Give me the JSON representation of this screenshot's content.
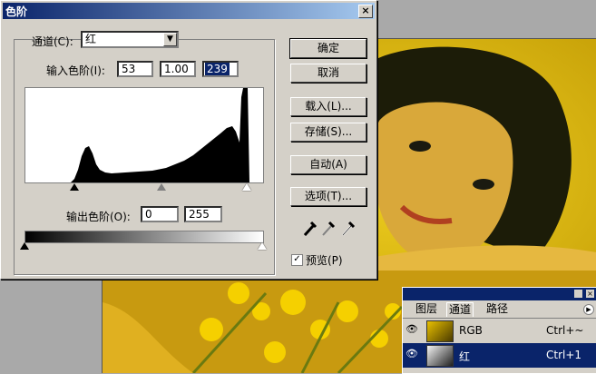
{
  "dialog": {
    "title": "色阶",
    "close_label": "×",
    "channel_label": "通道(C):",
    "channel_value": "红",
    "input_levels_label": "输入色阶(I):",
    "input_black": "53",
    "input_gamma": "1.00",
    "input_white": "239",
    "output_levels_label": "输出色阶(O):",
    "output_black": "0",
    "output_white": "255",
    "buttons": {
      "ok": "确定",
      "cancel": "取消",
      "load": "载入(L)...",
      "save": "存储(S)...",
      "auto": "自动(A)",
      "options": "选项(T)..."
    },
    "preview_label": "预览(P)",
    "preview_checked": true,
    "eyedropper_icons": [
      "black-eyedropper-icon",
      "gray-eyedropper-icon",
      "white-eyedropper-icon"
    ]
  },
  "panel": {
    "tabs": [
      "图层",
      "通道",
      "路径"
    ],
    "active_tab": "通道",
    "rows": [
      {
        "name": "RGB",
        "shortcut": "Ctrl+~",
        "selected": false
      },
      {
        "name": "红",
        "shortcut": "Ctrl+1",
        "selected": true
      }
    ]
  },
  "colors": {
    "dialog_bg": "#d4d0c8",
    "title_start": "#0a246a",
    "title_end": "#a6caf0",
    "selection": "#0a246a",
    "photo_yellow": "#d9b400"
  }
}
